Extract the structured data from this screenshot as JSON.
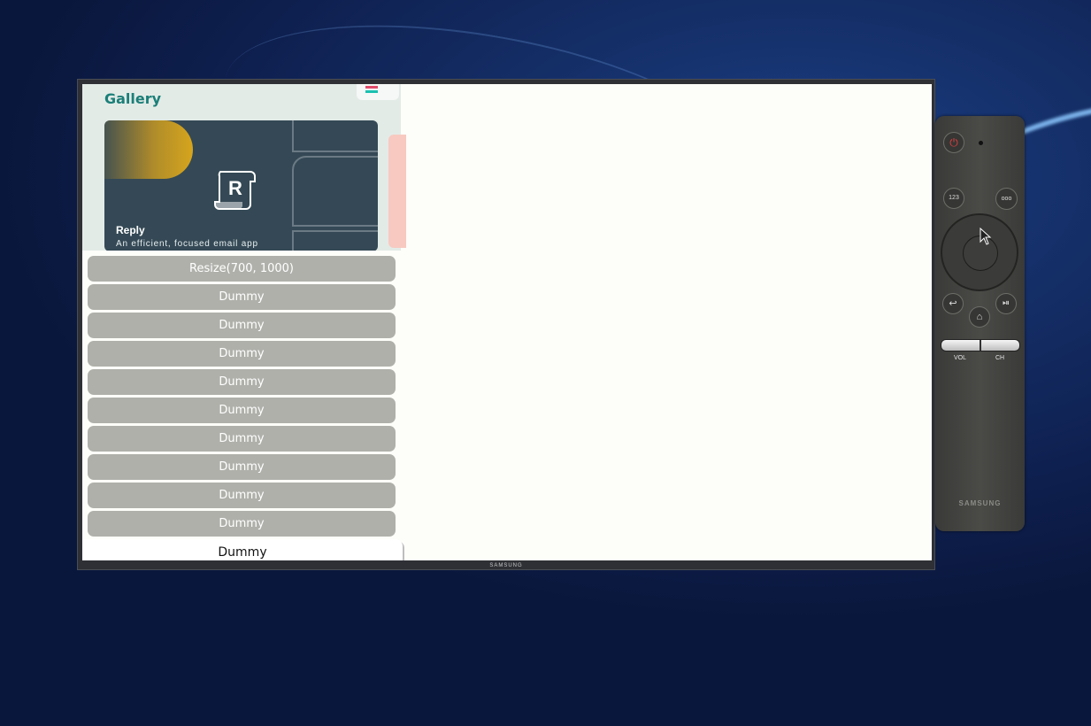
{
  "app": {
    "title": "Gallery",
    "card": {
      "name": "Reply",
      "description": "An efficient, focused email app",
      "logo_letter": "R",
      "accent": "#d6a51d",
      "background": "#344955"
    }
  },
  "menu": {
    "items": [
      {
        "label": "Resize(700, 1000)",
        "focused": false
      },
      {
        "label": "Dummy",
        "focused": false
      },
      {
        "label": "Dummy",
        "focused": false
      },
      {
        "label": "Dummy",
        "focused": false
      },
      {
        "label": "Dummy",
        "focused": false
      },
      {
        "label": "Dummy",
        "focused": false
      },
      {
        "label": "Dummy",
        "focused": false
      },
      {
        "label": "Dummy",
        "focused": false
      },
      {
        "label": "Dummy",
        "focused": false
      },
      {
        "label": "Dummy",
        "focused": false
      },
      {
        "label": "Dummy",
        "focused": true
      }
    ]
  },
  "tv": {
    "brand": "SAMSUNG"
  },
  "remote": {
    "brand": "SAMSUNG",
    "number_button": "123",
    "more_button": "ooo",
    "vol_label": "VOL",
    "ch_label": "CH",
    "icons": {
      "power": "power-icon",
      "back": "back-icon",
      "home": "home-icon",
      "play_pause": "play-pause-icon"
    }
  },
  "colors": {
    "title": "#1b7f78",
    "menu_button": "#b0b0ab",
    "focused_button": "#ffffff"
  }
}
